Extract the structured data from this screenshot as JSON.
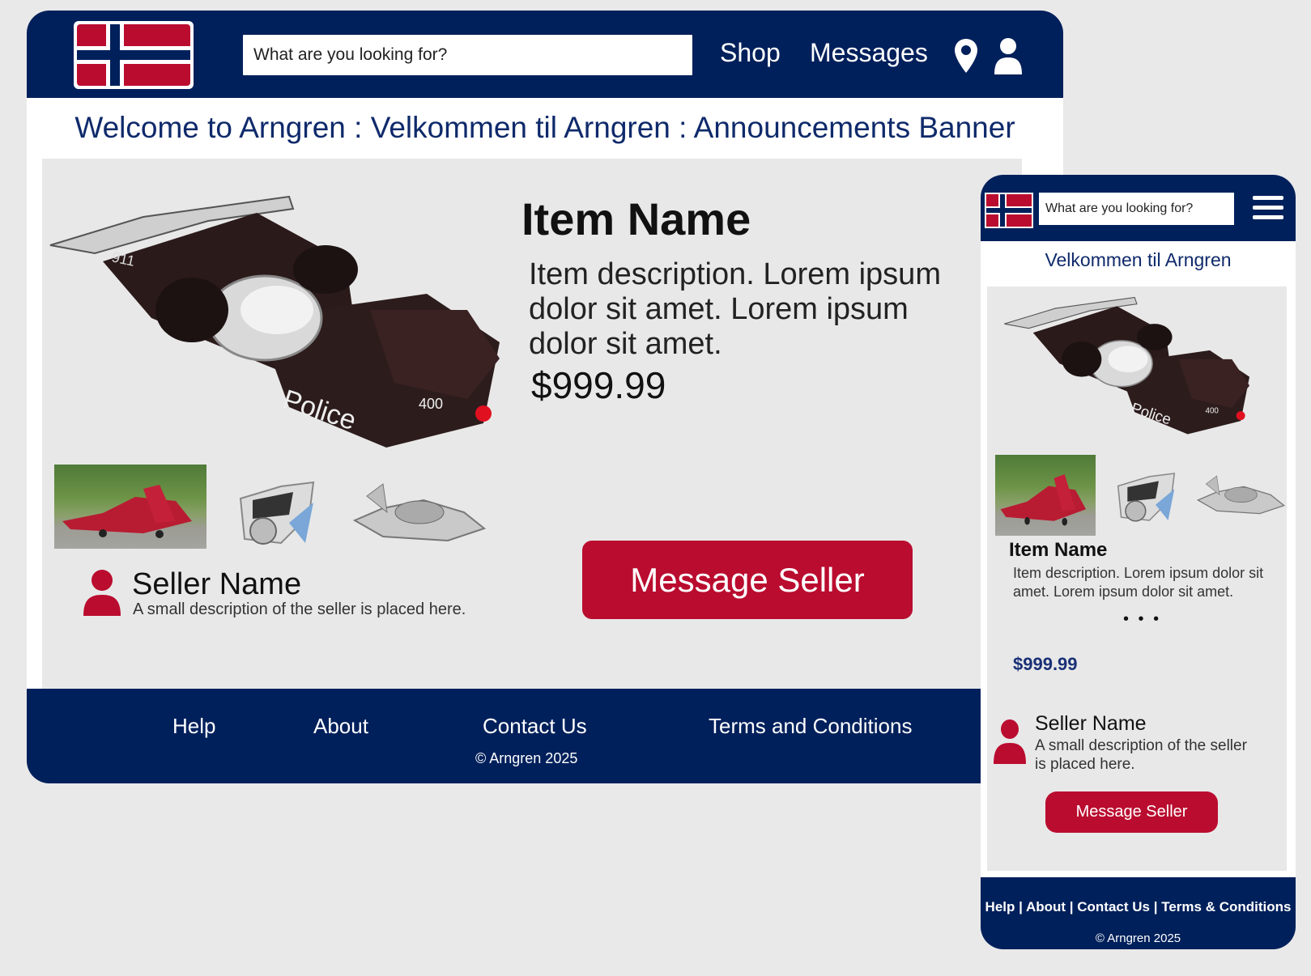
{
  "brand_colors": {
    "navy": "#00205b",
    "red": "#ba0c2f",
    "white": "#ffffff",
    "panel": "#e8e8e8"
  },
  "desktop": {
    "search": {
      "placeholder": "What are you looking for?"
    },
    "nav": {
      "shop": "Shop",
      "messages": "Messages",
      "icons": [
        "location-pin-icon",
        "user-account-icon"
      ]
    },
    "banner": "Welcome to Arngren : Velkommen til Arngren : Announcements Banner",
    "item": {
      "name": "Item Name",
      "description": "Item description. Lorem ipsum dolor sit amet. Lorem ipsum dolor sit amet.",
      "price": "$999.99"
    },
    "seller": {
      "name": "Seller Name",
      "description": "A small description of the seller is placed here."
    },
    "message_button": "Message Seller",
    "footer": {
      "links": [
        "Help",
        "About",
        "Contact Us",
        "Terms and Conditions"
      ],
      "copyright": "© Arngren 2025"
    }
  },
  "mobile": {
    "search": {
      "placeholder": "What are you looking for?"
    },
    "banner": "Velkommen til Arngren",
    "item": {
      "name": "Item Name",
      "description": "Item description. Lorem ipsum dolor sit amet. Lorem ipsum dolor sit amet.",
      "more": "• • •",
      "price": "$999.99"
    },
    "seller": {
      "name": "Seller Name",
      "description": "A small description of the seller is placed here."
    },
    "message_button": "Message Seller",
    "footer": {
      "links": [
        "Help",
        "About",
        "Contact Us",
        "Terms & Conditions"
      ],
      "separator": " | ",
      "copyright": "© Arngren 2025"
    }
  }
}
